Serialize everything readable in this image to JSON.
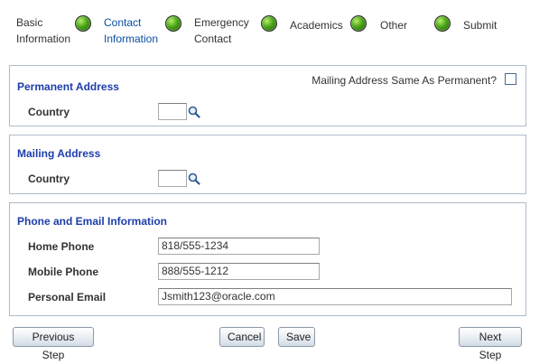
{
  "steps": [
    {
      "label_1": "Basic",
      "label_2": "Information",
      "active": false
    },
    {
      "label_1": "Contact",
      "label_2": "Information",
      "active": true
    },
    {
      "label_1": "Emergency",
      "label_2": "Contact",
      "active": false
    },
    {
      "label_1": "Academics",
      "label_2": "",
      "active": false
    },
    {
      "label_1": "Other",
      "label_2": "",
      "active": false
    },
    {
      "label_1": "Submit",
      "label_2": "",
      "active": false
    }
  ],
  "permanent_address": {
    "title": "Permanent Address",
    "mailing_same_label": "Mailing Address Same As Permanent?",
    "mailing_same_checked": false,
    "country_label": "Country",
    "country_value": ""
  },
  "mailing_address": {
    "title": "Mailing Address",
    "country_label": "Country",
    "country_value": ""
  },
  "phone_email": {
    "title": "Phone and Email Information",
    "home_phone_label": "Home Phone",
    "home_phone_value": "818/555-1234",
    "mobile_phone_label": "Mobile Phone",
    "mobile_phone_value": "888/555-1212",
    "email_label": "Personal Email",
    "email_value": "Jsmith123@oracle.com"
  },
  "buttons": {
    "previous": "Previous Step",
    "cancel": "Cancel",
    "save": "Save",
    "next": "Next Step"
  },
  "colors": {
    "section_title": "#1d3eaa",
    "active_step": "#0a4fa0",
    "section_border": "#aebccb"
  }
}
